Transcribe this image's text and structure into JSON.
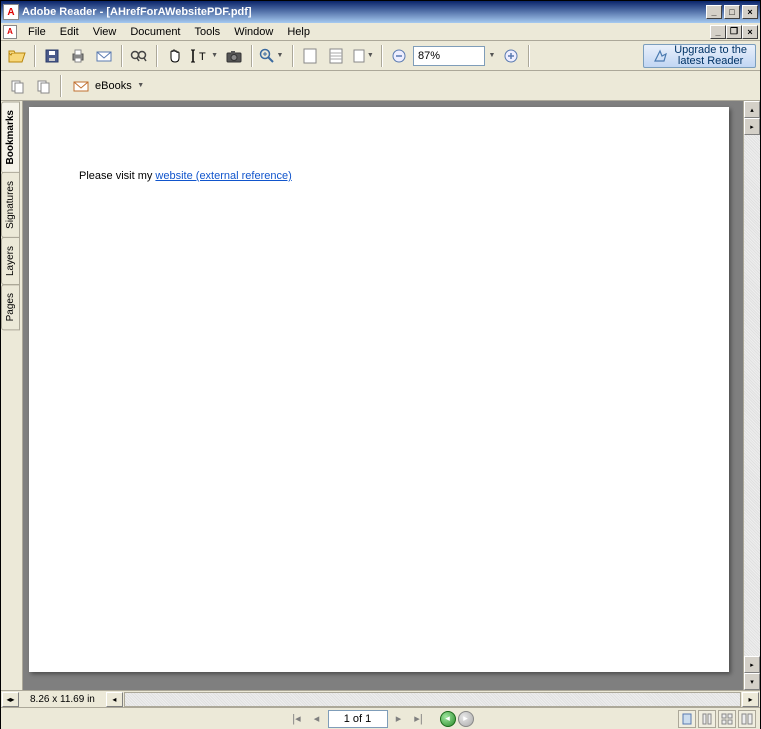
{
  "window": {
    "title": "Adobe Reader - [AHrefForAWebsitePDF.pdf]"
  },
  "menu": {
    "file": "File",
    "edit": "Edit",
    "view": "View",
    "document": "Document",
    "tools": "Tools",
    "window": "Window",
    "help": "Help"
  },
  "toolbar": {
    "zoom_value": "87%",
    "upgrade_line1": "Upgrade to the",
    "upgrade_line2": "latest Reader"
  },
  "toolbar2": {
    "ebooks_label": "eBooks"
  },
  "side_tabs": {
    "bookmarks": "Bookmarks",
    "signatures": "Signatures",
    "layers": "Layers",
    "pages": "Pages"
  },
  "document": {
    "text_prefix": "Please visit my ",
    "link_text": "website (external reference)"
  },
  "status": {
    "dimensions": "8.26 x 11.69 in"
  },
  "nav": {
    "page_display": "1 of 1"
  }
}
